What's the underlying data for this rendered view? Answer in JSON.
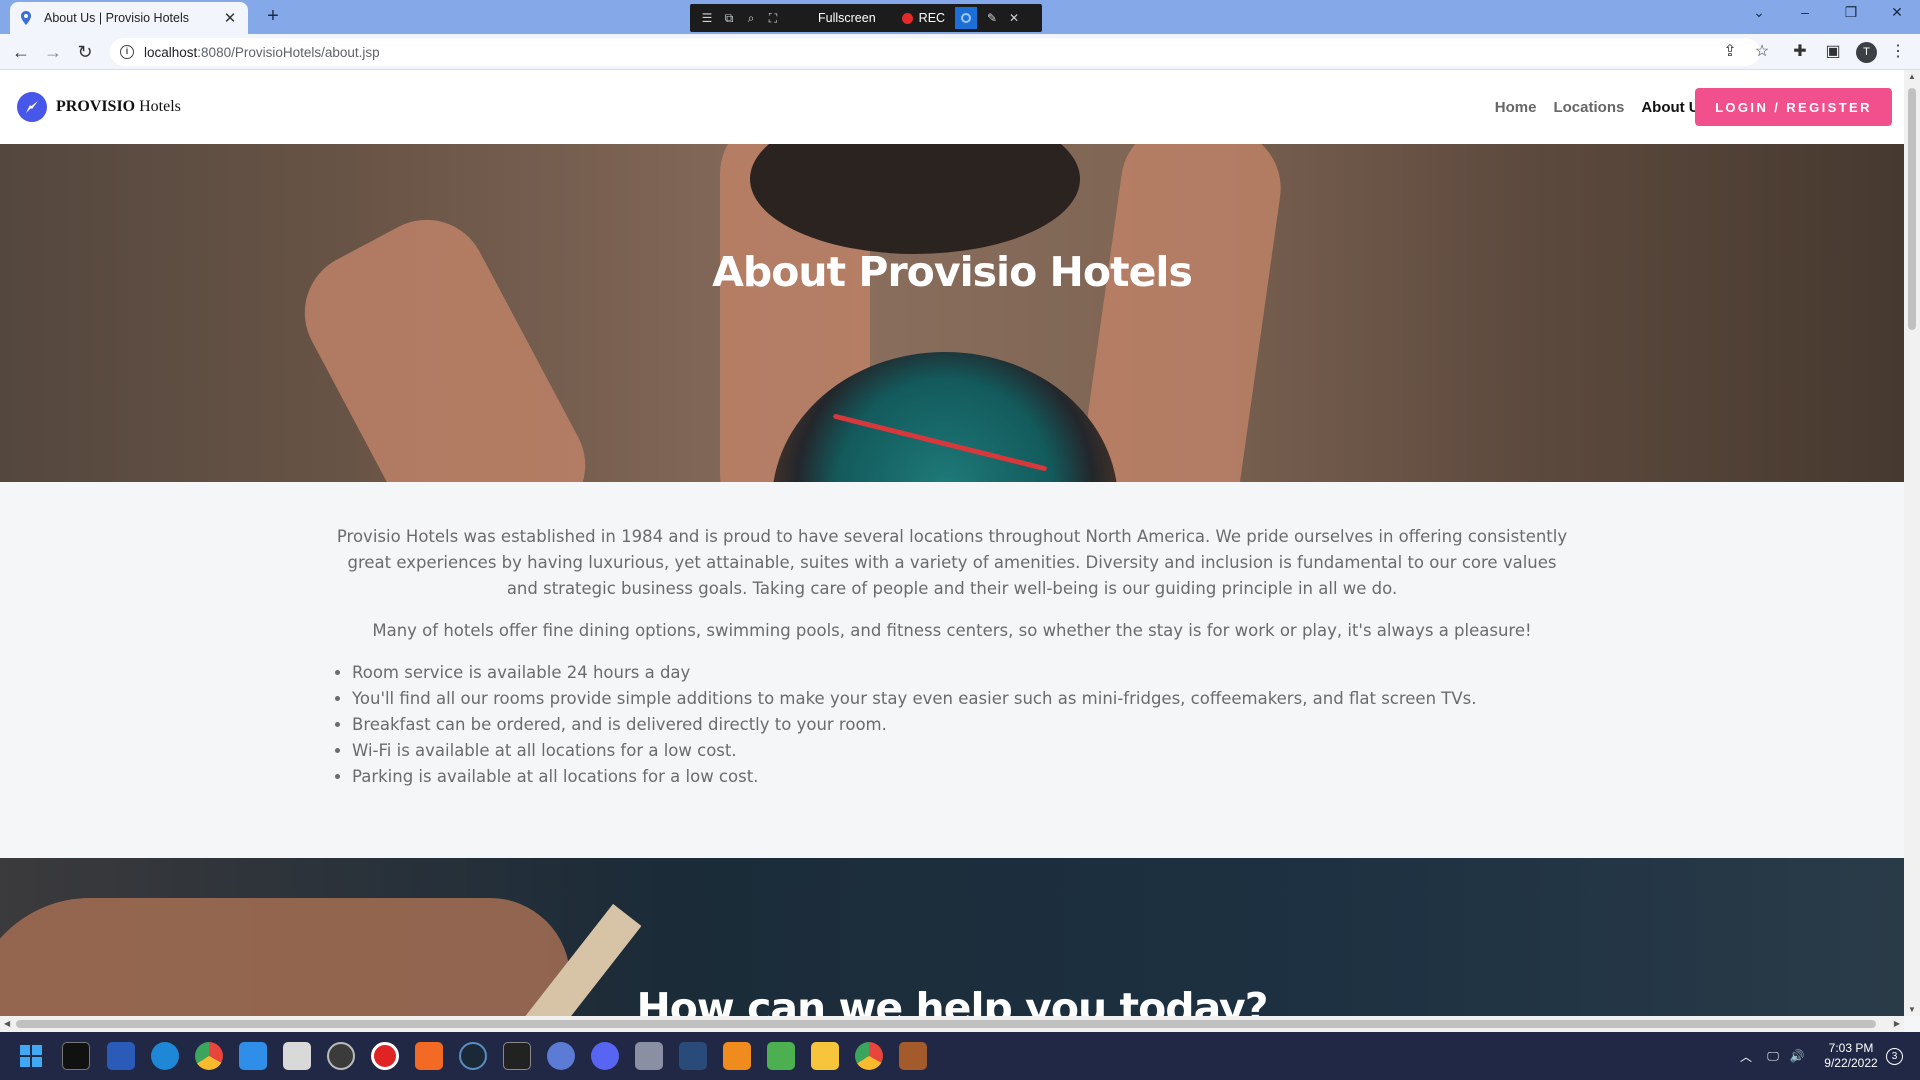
{
  "browser": {
    "tab_title": "About Us | Provisio Hotels",
    "tab_close": "✕",
    "new_tab": "+",
    "url_host": "localhost",
    "url_rest": ":8080/ProvisioHotels/about.jsp"
  },
  "recorder": {
    "fullscreen_label": "Fullscreen",
    "rec_label": "REC"
  },
  "site": {
    "brand_bold": "PROVISIO",
    "brand_rest": " Hotels",
    "nav": [
      "Home",
      "Locations",
      "About Us"
    ],
    "login_label": "LOGIN / REGISTER",
    "hero_title": "About Provisio Hotels",
    "paragraph1": "Provisio Hotels was established in 1984 and is proud to have several locations throughout North America. We pride ourselves in offering consistently great experiences by having luxurious, yet attainable, suites with a variety of amenities. Diversity and inclusion is fundamental to our core values and strategic business goals. Taking care of people and their well-being is our guiding principle in all we do.",
    "paragraph2": "Many of hotels offer fine dining options, swimming pools, and fitness centers, so whether the stay is for work or play, it's always a pleasure!",
    "features": [
      "Room service is available 24 hours a day",
      "You'll find all our rooms provide simple additions to make your stay even easier such as mini-fridges, coffeemakers, and flat screen TVs.",
      "Breakfast can be ordered, and is delivered directly to your room.",
      "Wi-Fi is available at all locations for a low cost.",
      "Parking is available at all locations for a low cost."
    ],
    "help_title": "How can we help you today?"
  },
  "taskbar": {
    "time": "7:03 PM",
    "date": "9/22/2022",
    "notifications": "3"
  },
  "colors": {
    "accent": "#f2508c",
    "logo": "#4757ea",
    "taskbar": "#202846",
    "tabstrip": "#85a9e8"
  }
}
